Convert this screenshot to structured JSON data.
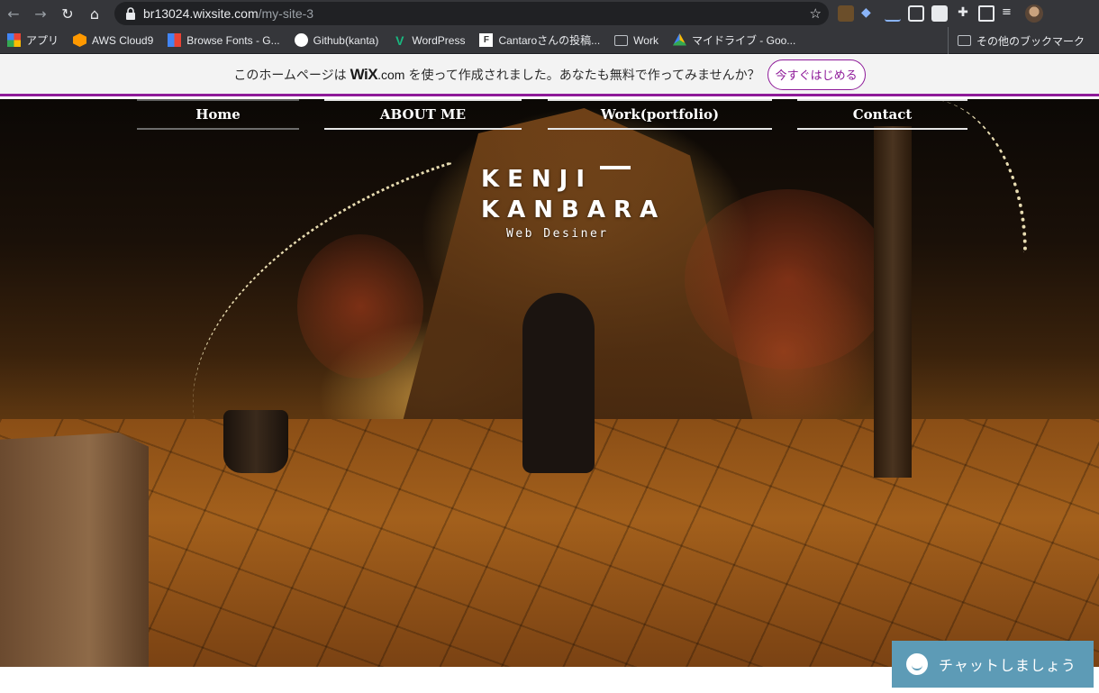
{
  "browser": {
    "url_host": "br13024.wixsite.com",
    "url_path": "/my-site-3",
    "bookmarks": [
      {
        "label": "アプリ",
        "icon": "apps-grid-icon",
        "color": "#ea4335"
      },
      {
        "label": "AWS Cloud9",
        "icon": "aws-cloud9-icon",
        "color": "#ff9900"
      },
      {
        "label": "Browse Fonts - G...",
        "icon": "google-fonts-icon",
        "color": "#4285f4"
      },
      {
        "label": "Github(kanta)",
        "icon": "github-icon",
        "color": "#ffffff"
      },
      {
        "label": "WordPress",
        "icon": "wordpress-icon",
        "color": "#19b880"
      },
      {
        "label": "Cantaroさんの投稿...",
        "icon": "page-icon",
        "color": "#ffffff"
      },
      {
        "label": "Work",
        "icon": "folder-icon",
        "color": "#bdc1c6"
      },
      {
        "label": "マイドライブ - Goo...",
        "icon": "google-drive-icon",
        "color": "#fbbc04"
      }
    ],
    "other_bookmarks": "その他のブックマーク"
  },
  "wix_banner": {
    "text_before": "このホームページは",
    "logo": "WiX",
    "logo_suffix": ".com",
    "text_after": "を使って作成されました。あなたも無料で作ってみませんか？",
    "cta": "今すぐはじめる",
    "accent": "#8e1a99"
  },
  "site": {
    "nav": [
      {
        "label": "Home"
      },
      {
        "label": "ABOUT ME"
      },
      {
        "label": "Work(portfolio)"
      },
      {
        "label": "Contact"
      }
    ],
    "title_line1": "KENJI",
    "title_line2": "KANBARA",
    "subtitle": "Web Desiner"
  },
  "chat": {
    "label": "チャットしましょう",
    "color": "#5d9bb6"
  }
}
